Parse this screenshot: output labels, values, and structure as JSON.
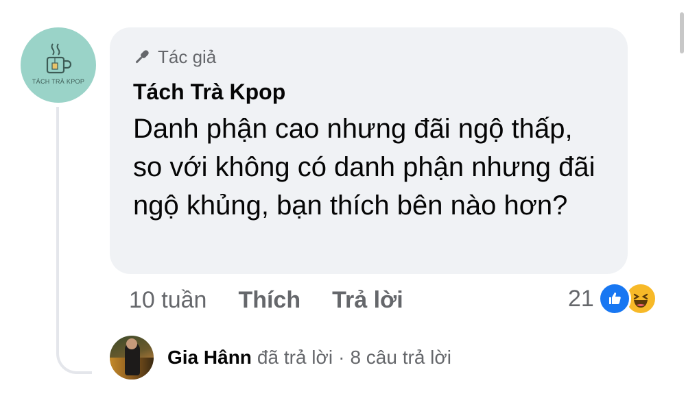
{
  "comment": {
    "avatar_brand": "TÁCH TRÀ KPOP",
    "badge_label": "Tác giả",
    "author": "Tách Trà Kpop",
    "text": "Danh phận cao nhưng đãi ngộ thấp, so với không có danh phận nhưng đãi ngộ khủng, bạn thích bên nào hơn?",
    "time": "10 tuần",
    "like_label": "Thích",
    "reply_label": "Trả lời",
    "reaction_count": "21",
    "reactions": [
      "like",
      "haha"
    ]
  },
  "replies": {
    "name": "Gia Hânn",
    "action": "đã trả lời",
    "separator": "·",
    "count_label": "8 câu trả lời"
  },
  "colors": {
    "bubble": "#f0f2f5",
    "muted_text": "#65676b",
    "like_blue": "#1877f2",
    "haha_yellow": "#f7b928",
    "avatar_teal": "#9ad3c8"
  }
}
